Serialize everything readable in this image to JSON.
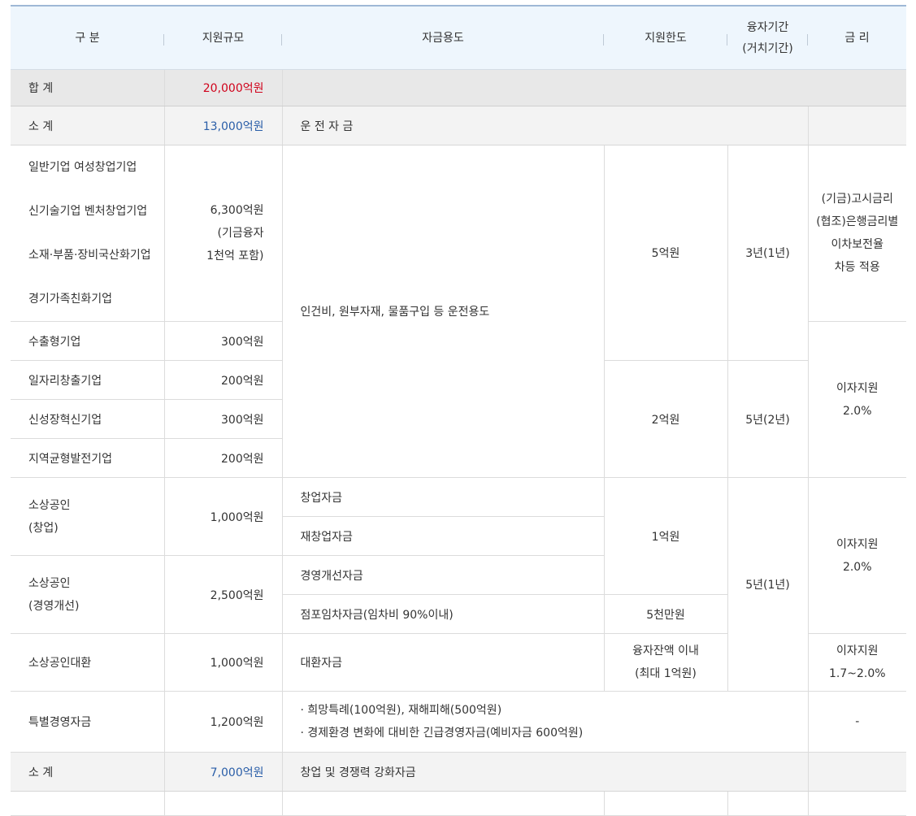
{
  "header": {
    "col1": "구 분",
    "col2": "지원규모",
    "col3": "자금용도",
    "col4": "지원한도",
    "col5_line1": "융자기간",
    "col5_line2": "(거치기간)",
    "col6": "금 리"
  },
  "total": {
    "label": "합 계",
    "amount": "20,000억원"
  },
  "subtotal1": {
    "label": "소 계",
    "amount": "13,000억원",
    "purpose": "운 전 자 금"
  },
  "group1": {
    "names": [
      "일반기업 여성창업기업",
      "신기술기업 벤처창업기업",
      "소재·부품·장비국산화기업",
      "경기가족친화기업"
    ],
    "amount_line1": "6,300억원",
    "amount_line2": "(기금융자",
    "amount_line3": "1천억 포함)",
    "purpose": "인건비, 원부자재, 물품구입 등 운전용도",
    "limit": "5억원",
    "period": "3년(1년)",
    "rate_line1": "(기금)고시금리",
    "rate_line2": "(협조)은행금리별",
    "rate_line3": "이차보전율",
    "rate_line4": "차등 적용"
  },
  "export": {
    "name": "수출형기업",
    "amount": "300억원"
  },
  "jobs": {
    "name": "일자리창출기업",
    "amount": "200억원"
  },
  "growth": {
    "name": "신성장혁신기업",
    "amount": "300억원"
  },
  "regional": {
    "name": "지역균형발전기업",
    "amount": "200억원"
  },
  "group2": {
    "limit": "2억원",
    "period": "5년(2년)",
    "rate_line1": "이자지원",
    "rate_line2": "2.0%"
  },
  "smallbiz_start": {
    "name_line1": "소상공인",
    "name_line2": "(창업)",
    "amount": "1,000억원",
    "purpose_a": "창업자금",
    "purpose_b": "재창업자금",
    "limit": "1억원"
  },
  "smallbiz_improve": {
    "name_line1": "소상공인",
    "name_line2": "(경영개선)",
    "amount": "2,500억원",
    "purpose_a": "경영개선자금",
    "purpose_b": "점포임차자금(임차비 90%이내)",
    "limit_b": "5천만원"
  },
  "group3": {
    "period": "5년(1년)",
    "rate_line1": "이자지원",
    "rate_line2": "2.0%"
  },
  "refinance": {
    "name": "소상공인대환",
    "amount": "1,000억원",
    "purpose": "대환자금",
    "limit_line1": "융자잔액 이내",
    "limit_line2": "(최대 1억원)",
    "rate_line1": "이자지원",
    "rate_line2": "1.7~2.0%"
  },
  "special": {
    "name": "특별경영자금",
    "amount": "1,200억원",
    "purpose_line1": "· 희망특례(100억원), 재해피해(500억원)",
    "purpose_line2": "· 경제환경 변화에 대비한 긴급경영자금(예비자금 600억원)",
    "rate": "-"
  },
  "subtotal2": {
    "label": "소 계",
    "amount": "7,000억원",
    "purpose": "창업 및 경쟁력 강화자금"
  }
}
